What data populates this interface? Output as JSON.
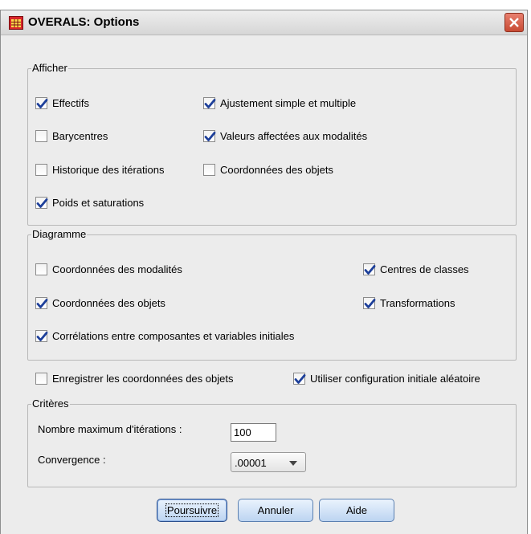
{
  "window": {
    "title": "OVERALS: Options"
  },
  "afficher": {
    "legend": "Afficher",
    "items": [
      {
        "label": "Effectifs",
        "checked": true
      },
      {
        "label": "Ajustement simple et multiple",
        "checked": true
      },
      {
        "label": "Barycentres",
        "checked": false
      },
      {
        "label": "Valeurs affectées aux modalités",
        "checked": true
      },
      {
        "label": "Historique des itérations",
        "checked": false
      },
      {
        "label": "Coordonnées des objets",
        "checked": false
      },
      {
        "label": "Poids et saturations",
        "checked": true
      }
    ]
  },
  "diagramme": {
    "legend": "Diagramme",
    "items": [
      {
        "label": "Coordonnées des modalités",
        "checked": false
      },
      {
        "label": "Centres de classes",
        "checked": true
      },
      {
        "label": "Coordonnées des objets",
        "checked": true
      },
      {
        "label": "Transformations",
        "checked": true
      },
      {
        "label": "Corrélations entre composantes et variables initiales",
        "checked": true
      }
    ]
  },
  "options": [
    {
      "label": "Enregistrer les coordonnées des objets",
      "checked": false
    },
    {
      "label": "Utiliser configuration initiale aléatoire",
      "checked": true
    }
  ],
  "criteres": {
    "legend": "Critères",
    "max_iter_label": "Nombre maximum d'itérations :",
    "max_iter_value": "100",
    "convergence_label": "Convergence :",
    "convergence_value": ".00001"
  },
  "buttons": {
    "continue": "Poursuivre",
    "cancel": "Annuler",
    "help": "Aide"
  },
  "colors": {
    "check": "#1d3f9a",
    "accent": "#c84a33"
  }
}
